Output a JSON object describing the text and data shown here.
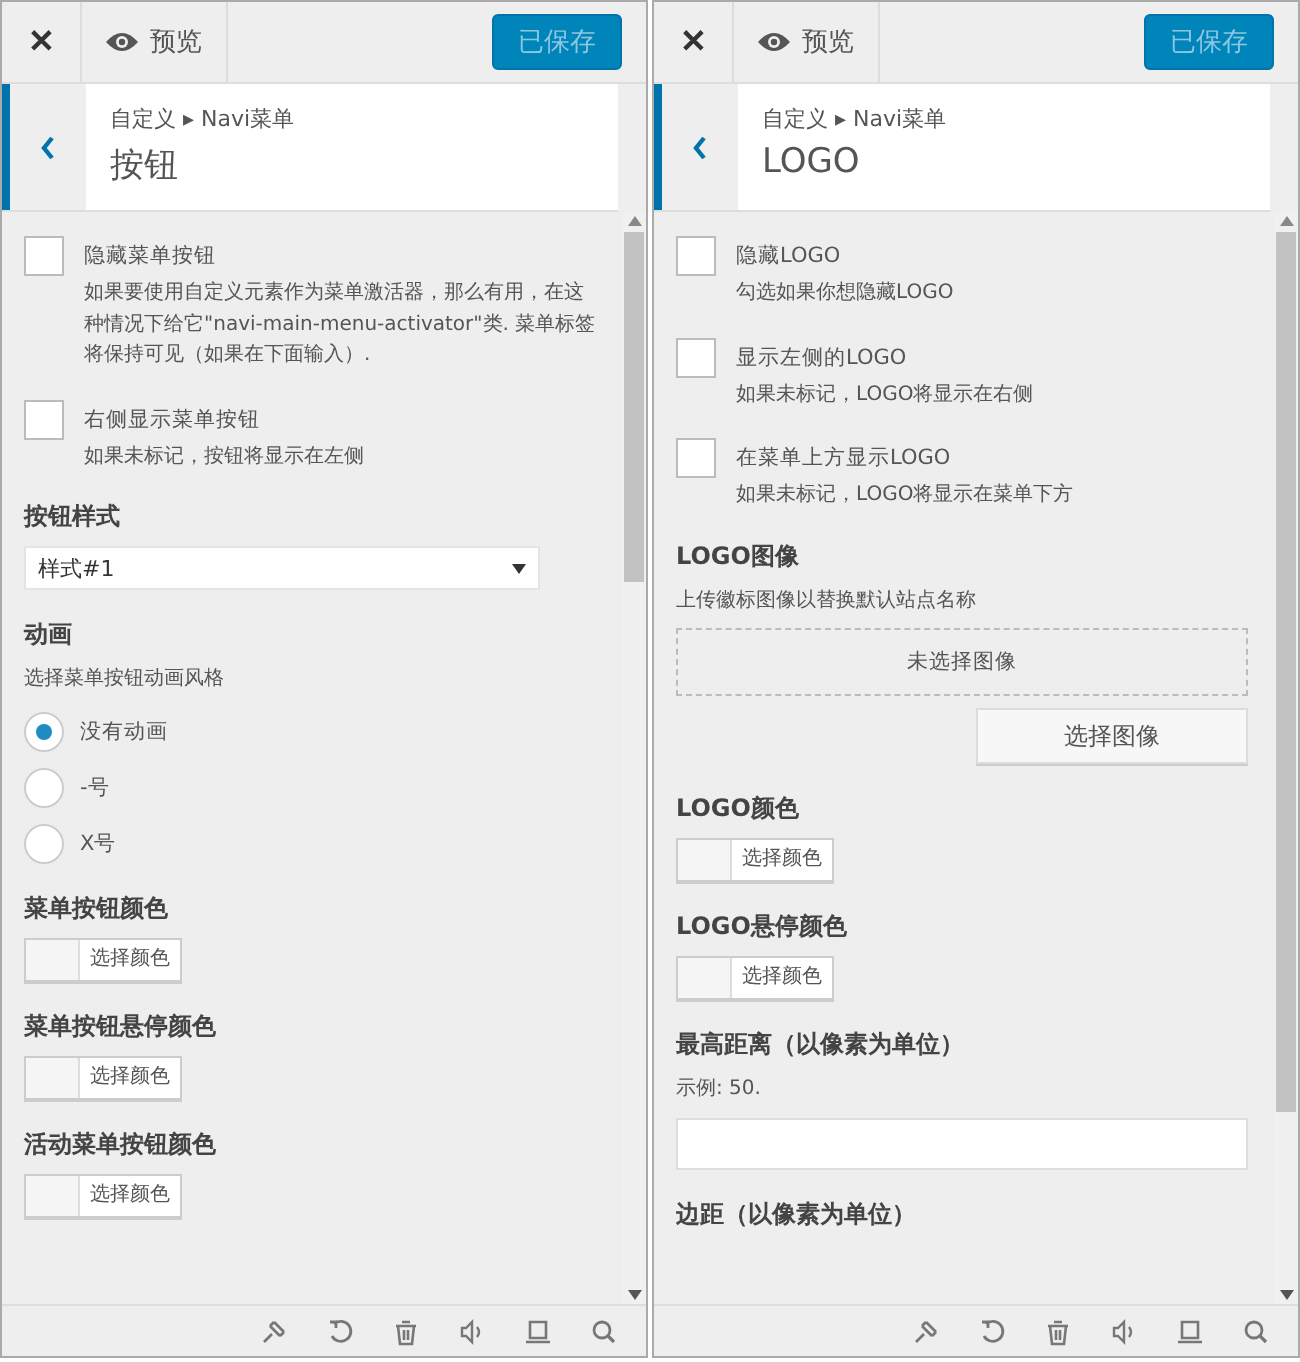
{
  "panels": [
    {
      "close": "✕",
      "preview": "预览",
      "save": "已保存",
      "breadcrumb": "自定义 ▸ Navi菜单",
      "title": "按钮",
      "controls": [
        {
          "kind": "checkbox",
          "label": "隐藏菜单按钮",
          "description": "如果要使用自定义元素作为菜单激活器，那么有用，在这种情况下给它\"navi-main-menu-activator\"类. 菜单标签将保持可见（如果在下面输入）.",
          "checked": false
        },
        {
          "kind": "checkbox",
          "label": "右侧显示菜单按钮",
          "description": "如果未标记，按钮将显示在左侧",
          "checked": false
        },
        {
          "kind": "select",
          "title": "按钮样式",
          "value": "样式#1"
        },
        {
          "kind": "radio",
          "title": "动画",
          "description": "选择菜单按钮动画风格",
          "options": [
            {
              "label": "没有动画",
              "selected": true
            },
            {
              "label": "-号",
              "selected": false
            },
            {
              "label": "X号",
              "selected": false
            }
          ]
        },
        {
          "kind": "color",
          "title": "菜单按钮颜色",
          "button": "选择颜色"
        },
        {
          "kind": "color",
          "title": "菜单按钮悬停颜色",
          "button": "选择颜色"
        },
        {
          "kind": "color",
          "title": "活动菜单按钮颜色",
          "button": "选择颜色"
        }
      ]
    },
    {
      "close": "✕",
      "preview": "预览",
      "save": "已保存",
      "breadcrumb": "自定义 ▸ Navi菜单",
      "title": "LOGO",
      "controls": [
        {
          "kind": "checkbox",
          "label": "隐藏LOGO",
          "description": "勾选如果你想隐藏LOGO",
          "checked": false
        },
        {
          "kind": "checkbox",
          "label": "显示左侧的LOGO",
          "description": "如果未标记，LOGO将显示在右侧",
          "checked": false
        },
        {
          "kind": "checkbox",
          "label": "在菜单上方显示LOGO",
          "description": "如果未标记，LOGO将显示在菜单下方",
          "checked": false
        },
        {
          "kind": "image",
          "title": "LOGO图像",
          "description": "上传徽标图像以替换默认站点名称",
          "placeholder": "未选择图像",
          "button": "选择图像"
        },
        {
          "kind": "color",
          "title": "LOGO颜色",
          "button": "选择颜色"
        },
        {
          "kind": "color",
          "title": "LOGO悬停颜色",
          "button": "选择颜色"
        },
        {
          "kind": "text",
          "title": "最高距离（以像素为单位）",
          "description": "示例: 50."
        },
        {
          "kind": "heading",
          "title": "边距（以像素为单位）"
        }
      ]
    }
  ]
}
